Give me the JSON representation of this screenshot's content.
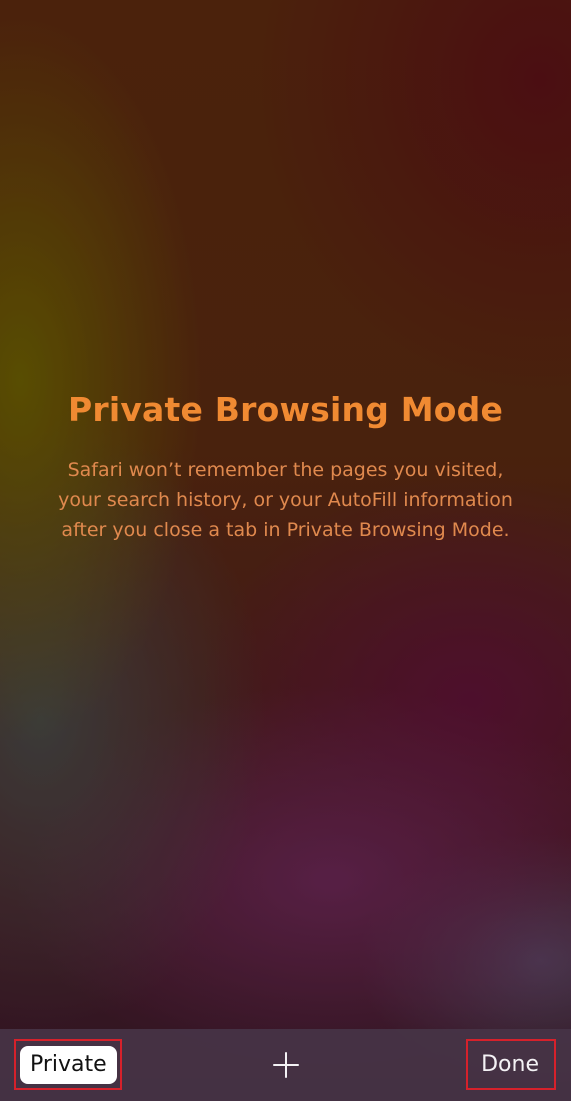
{
  "private_mode": {
    "title": "Private Browsing Mode",
    "message": "Safari won’t remember the pages you visited, your search history, or your AutoFill information after you close a tab in Private Browsing Mode."
  },
  "toolbar": {
    "private_label": "Private",
    "add_icon": "plus-icon",
    "done_label": "Done"
  },
  "colors": {
    "title": "#f08a32",
    "message": "#e0894e",
    "highlight": "#d6212b",
    "toolbar": "#463446"
  }
}
